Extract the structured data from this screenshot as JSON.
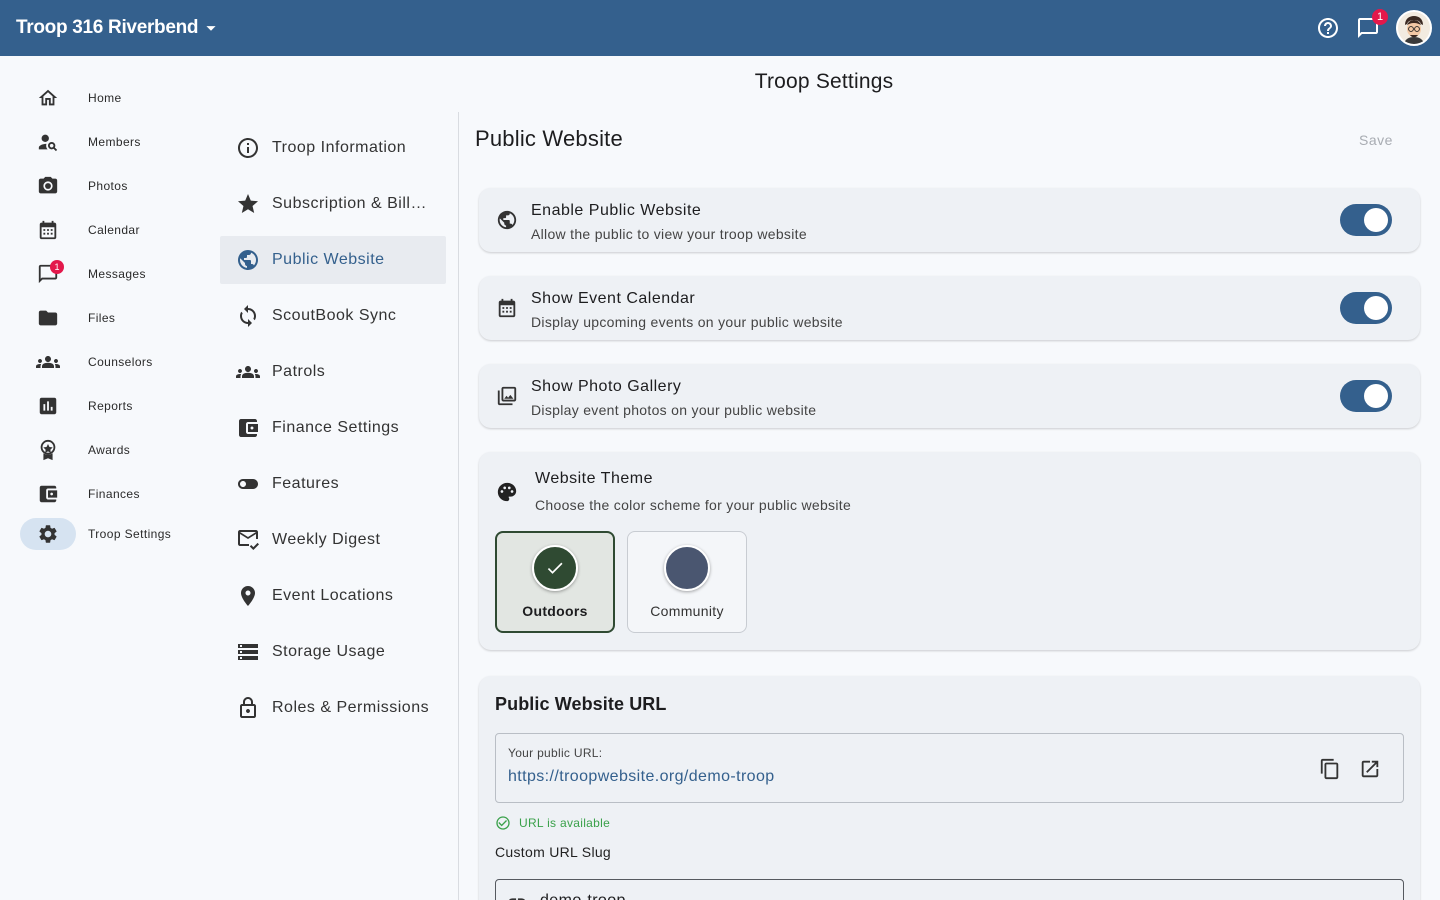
{
  "header": {
    "troop_name": "Troop 316 Riverbend",
    "messages_badge": "1",
    "icons": [
      "help-icon",
      "chat-icon",
      "avatar"
    ]
  },
  "nav": {
    "items": [
      {
        "label": "Home",
        "icon": "home-icon"
      },
      {
        "label": "Members",
        "icon": "person-search-icon"
      },
      {
        "label": "Photos",
        "icon": "camera-icon"
      },
      {
        "label": "Calendar",
        "icon": "calendar-icon"
      },
      {
        "label": "Messages",
        "icon": "chat-icon",
        "badge": "1"
      },
      {
        "label": "Files",
        "icon": "folder-icon"
      },
      {
        "label": "Counselors",
        "icon": "groups-icon"
      },
      {
        "label": "Reports",
        "icon": "bar-chart-icon"
      },
      {
        "label": "Awards",
        "icon": "award-icon"
      },
      {
        "label": "Finances",
        "icon": "wallet-icon"
      },
      {
        "label": "Troop Settings",
        "icon": "gear-icon",
        "active": true
      }
    ]
  },
  "page": {
    "title": "Troop Settings"
  },
  "settings_menu": {
    "items": [
      {
        "label": "Troop Information",
        "icon": "info-icon"
      },
      {
        "label": "Subscription & Billing",
        "icon": "star-icon"
      },
      {
        "label": "Public Website",
        "icon": "globe-icon",
        "active": true
      },
      {
        "label": "ScoutBook Sync",
        "icon": "sync-icon"
      },
      {
        "label": "Patrols",
        "icon": "groups-icon"
      },
      {
        "label": "Finance Settings",
        "icon": "wallet-icon"
      },
      {
        "label": "Features",
        "icon": "toggle-icon"
      },
      {
        "label": "Weekly Digest",
        "icon": "mail-check-icon"
      },
      {
        "label": "Event Locations",
        "icon": "location-pin-icon"
      },
      {
        "label": "Storage Usage",
        "icon": "storage-icon"
      },
      {
        "label": "Roles & Permissions",
        "icon": "lock-icon"
      }
    ]
  },
  "content": {
    "section_title": "Public Website",
    "save_label": "Save",
    "toggles": [
      {
        "title": "Enable Public Website",
        "subtitle": "Allow the public to view your troop website",
        "icon": "globe-icon",
        "on": true
      },
      {
        "title": "Show Event Calendar",
        "subtitle": "Display upcoming events on your public website",
        "icon": "calendar-icon",
        "on": true
      },
      {
        "title": "Show Photo Gallery",
        "subtitle": "Display event photos on your public website",
        "icon": "photo-library-icon",
        "on": true
      }
    ],
    "theme": {
      "title": "Website Theme",
      "subtitle": "Choose the color scheme for your public website",
      "icon": "palette-icon",
      "options": [
        {
          "label": "Outdoors",
          "color": "#2f4a32",
          "selected": true
        },
        {
          "label": "Community",
          "color": "#4a5670",
          "selected": false
        }
      ]
    },
    "url": {
      "title": "Public Website URL",
      "box_label": "Your public URL:",
      "link": "https://troopwebsite.org/demo-troop",
      "availability": "URL is available",
      "slug_label": "Custom URL Slug",
      "slug_value": "demo-troop"
    }
  },
  "colors": {
    "primary": "#34608d",
    "badge": "#e3184b",
    "success": "#3aa14a",
    "theme_outdoors": "#2f4a32",
    "theme_community": "#4a5670"
  }
}
